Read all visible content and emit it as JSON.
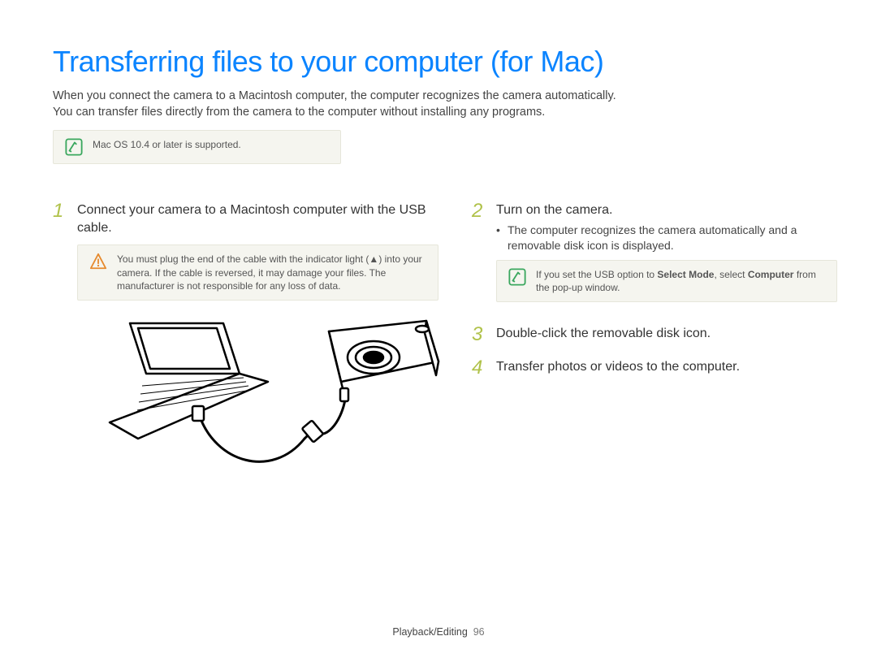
{
  "title": "Transferring files to your computer (for Mac)",
  "intro_line1": "When you connect the camera to a Macintosh computer, the computer recognizes the camera automatically.",
  "intro_line2": "You can transfer files directly from the camera to the computer without installing any programs.",
  "top_note": "Mac OS 10.4 or later is supported.",
  "left": {
    "step1_num": "1",
    "step1_text": "Connect your camera to a Macintosh computer with the USB cable.",
    "warn_text_a": "You must plug the end of the cable with the indicator light (",
    "warn_text_b": ") into your camera. If the cable is reversed, it may damage your files. The manufacturer is not responsible for any loss of data."
  },
  "right": {
    "step2_num": "2",
    "step2_text": "Turn on the camera.",
    "step2_bullet": "The computer recognizes the camera automatically and a removable disk icon is displayed.",
    "note2_a": "If you set the USB option to ",
    "note2_bold1": "Select Mode",
    "note2_b": ", select ",
    "note2_bold2": "Computer",
    "note2_c": " from the pop-up window.",
    "step3_num": "3",
    "step3_text": "Double-click the removable disk icon.",
    "step4_num": "4",
    "step4_text": "Transfer photos or videos to the computer."
  },
  "footer": {
    "section": "Playback/Editing",
    "page": "96"
  }
}
